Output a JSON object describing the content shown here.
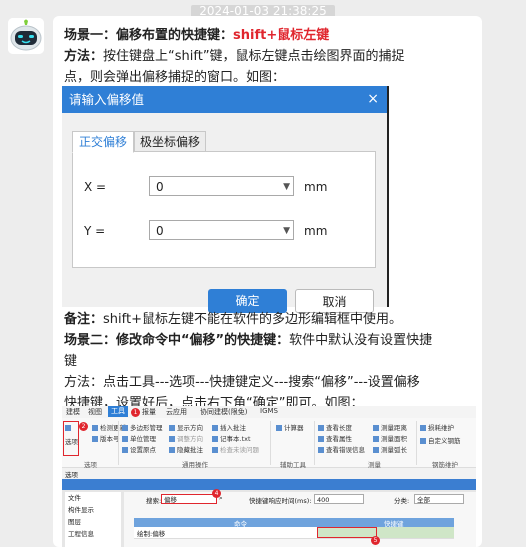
{
  "chat": {
    "timestamp": "2024-01-03 21:38:25"
  },
  "msg": {
    "s1_title": "场景一：偏移布置的快捷键：",
    "s1_key": "shift+鼠标左键",
    "method_label": "方法：",
    "method_text1": "按住键盘上“shift”键，鼠标左键点击绘图界面的捕捉",
    "method_text2": "点，则会弹出偏移捕捉的窗口。如图：",
    "note_label": "备注：",
    "note_text": "shift+鼠标左键不能在软件的多边形编辑框中使用。",
    "s2_title": "场景二：修改命令中“偏移”的快捷键：",
    "s2_text1": "软件中默认没有设置快捷",
    "s2_text2": "键",
    "m2_text1": "方法：点击工具---选项---快捷键定义---搜索“偏移”---设置偏移",
    "m2_text2": "快捷键，设置好后，点击右下角“确定”即可。如图："
  },
  "dialog": {
    "title": "请输入偏移值",
    "close": "×",
    "tab_ortho": "正交偏移",
    "tab_polar": "极坐标偏移",
    "x_label": "X =",
    "x_value": "0",
    "y_label": "Y =",
    "y_value": "0",
    "unit": "mm",
    "ok": "确定",
    "cancel": "取消"
  },
  "software": {
    "menu": [
      "建模",
      "视图",
      "工具",
      "报量",
      "云应用",
      "协同建模(限免)",
      "IGMS"
    ],
    "ribbon": {
      "options": "选项",
      "check_update": "检测更新",
      "version": "版本号",
      "multi_layer": "多边形管理",
      "unit_settings": "单位管理",
      "origin": "设置原点",
      "show_dir": "显示方向",
      "adjust_dir": "调整方向",
      "hide_items": "隐藏批注",
      "insert_note": "插入批注",
      "notepad": "记事本.txt",
      "check_all": "检查未读问题",
      "calculator": "计算器",
      "query_len": "查看长度",
      "query_attr": "查看属性",
      "query_err": "查看错误信息",
      "measure_dist": "测量距离",
      "measure_area": "测量面积",
      "measure_arc": "测量弧长",
      "steel_maint": "损耗维护",
      "custom_steel": "自定义钢筋",
      "g_options": "选项",
      "g_common": "通用操作",
      "g_assist": "辅助工具",
      "g_measure": "测量",
      "g_steel": "钢筋维护"
    },
    "lower": {
      "header": "选项",
      "list": [
        "文件",
        "构件显示",
        "图层",
        "工程信息"
      ],
      "search_label": "搜索:",
      "search_value": "偏移",
      "timeout_label": "快捷键响应时间(ms):",
      "timeout_value": "400",
      "category_label": "分类:",
      "category_value": "全部",
      "col_cmd": "命令",
      "col_key": "快捷键",
      "row_cmd": "绘制:偏移"
    },
    "badges": [
      "1",
      "2",
      "3",
      "4",
      "5"
    ]
  }
}
